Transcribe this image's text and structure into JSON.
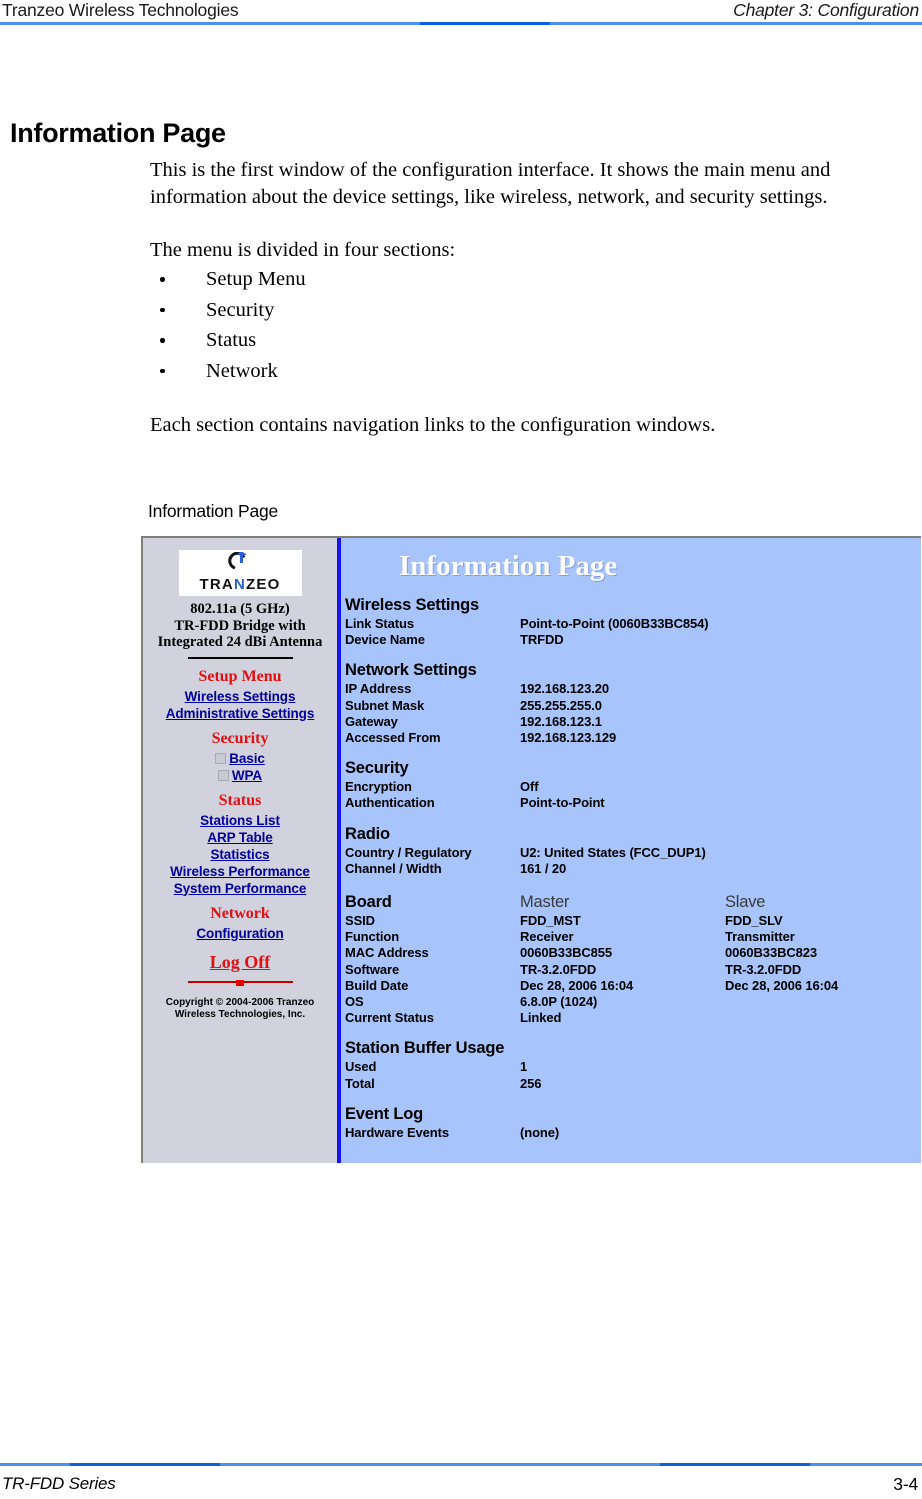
{
  "header": {
    "left": "Tranzeo Wireless Technologies",
    "right": "Chapter 3: Configuration"
  },
  "footer": {
    "left": "TR-FDD Series",
    "right": "3-4"
  },
  "document": {
    "section_title": "Information Page",
    "intro_paragraph": "This is the first window of the configuration interface. It shows the main menu and information about the device settings, like wireless, network, and security settings.",
    "menu_intro": "The menu is divided in four sections:",
    "bullets": [
      "Setup Menu",
      "Security",
      "Status",
      "Network"
    ],
    "closing_paragraph": "Each section contains navigation links to the configuration windows.",
    "figure_caption": "Information Page"
  },
  "screenshot": {
    "sidebar": {
      "logo_word_before": "TRA",
      "logo_word_n": "N",
      "logo_word_after": "ZEO",
      "device_desc_line1": "802.11a (5 GHz)",
      "device_desc_line2": "TR-FDD Bridge with",
      "device_desc_line3": "Integrated 24 dBi Antenna",
      "groups": [
        {
          "title": "Setup Menu",
          "links": [
            {
              "label": "Wireless Settings",
              "checkbox": false
            },
            {
              "label": "Administrative Settings",
              "checkbox": false
            }
          ]
        },
        {
          "title": "Security",
          "links": [
            {
              "label": "Basic",
              "checkbox": true
            },
            {
              "label": "WPA",
              "checkbox": true
            }
          ]
        },
        {
          "title": "Status",
          "links": [
            {
              "label": "Stations List",
              "checkbox": false
            },
            {
              "label": "ARP Table",
              "checkbox": false
            },
            {
              "label": "Statistics",
              "checkbox": false
            },
            {
              "label": "Wireless Performance",
              "checkbox": false
            },
            {
              "label": "System Performance",
              "checkbox": false
            }
          ]
        },
        {
          "title": "Network",
          "links": [
            {
              "label": "Configuration",
              "checkbox": false
            }
          ]
        }
      ],
      "logoff_label": "Log Off",
      "copyright": "Copyright © 2004-2006 Tranzeo Wireless Technologies, Inc."
    },
    "main": {
      "title": "Information Page",
      "wireless_settings": {
        "heading": "Wireless Settings",
        "rows": [
          {
            "label": "Link Status",
            "value": "Point-to-Point (0060B33BC854)"
          },
          {
            "label": "Device Name",
            "value": "TRFDD"
          }
        ]
      },
      "network_settings": {
        "heading": "Network Settings",
        "rows": [
          {
            "label": "IP Address",
            "value": "192.168.123.20"
          },
          {
            "label": "Subnet Mask",
            "value": "255.255.255.0"
          },
          {
            "label": "Gateway",
            "value": "192.168.123.1"
          },
          {
            "label": "Accessed From",
            "value": "192.168.123.129"
          }
        ]
      },
      "security": {
        "heading": "Security",
        "rows": [
          {
            "label": "Encryption",
            "value": "Off"
          },
          {
            "label": "Authentication",
            "value": "Point-to-Point"
          }
        ]
      },
      "radio": {
        "heading": "Radio",
        "rows": [
          {
            "label": "Country / Regulatory",
            "value": "U2: United States (FCC_DUP1)"
          },
          {
            "label": "Channel / Width",
            "value": "161 / 20"
          }
        ]
      },
      "board": {
        "heading": "Board",
        "col_master": "Master",
        "col_slave": "Slave",
        "rows": [
          {
            "label": "SSID",
            "master": "FDD_MST",
            "slave": "FDD_SLV"
          },
          {
            "label": "Function",
            "master": "Receiver",
            "slave": "Transmitter"
          },
          {
            "label": "MAC Address",
            "master": "0060B33BC855",
            "slave": "0060B33BC823"
          },
          {
            "label": "Software",
            "master": "TR-3.2.0FDD",
            "slave": "TR-3.2.0FDD"
          },
          {
            "label": "Build Date",
            "master": "Dec 28, 2006 16:04",
            "slave": "Dec 28, 2006 16:04"
          },
          {
            "label": "OS",
            "master": "6.8.0P (1024)",
            "slave": ""
          },
          {
            "label": "Current Status",
            "master": "Linked",
            "slave": ""
          }
        ]
      },
      "station_buffer": {
        "heading": "Station Buffer Usage",
        "rows": [
          {
            "label": "Used",
            "value": "1"
          },
          {
            "label": "Total",
            "value": "256"
          }
        ]
      },
      "event_log": {
        "heading": "Event Log",
        "rows": [
          {
            "label": "Hardware Events",
            "value": "(none)"
          }
        ]
      }
    }
  },
  "colors": {
    "rule_light": "#4d8ff0",
    "rule_dark": "#0b5fe0",
    "panel_blue": "#a8c4fd",
    "sidebar_grey": "#d2d2de",
    "divider_blue": "#1515ee",
    "link_blue": "#00009f",
    "group_red": "#e01010"
  }
}
